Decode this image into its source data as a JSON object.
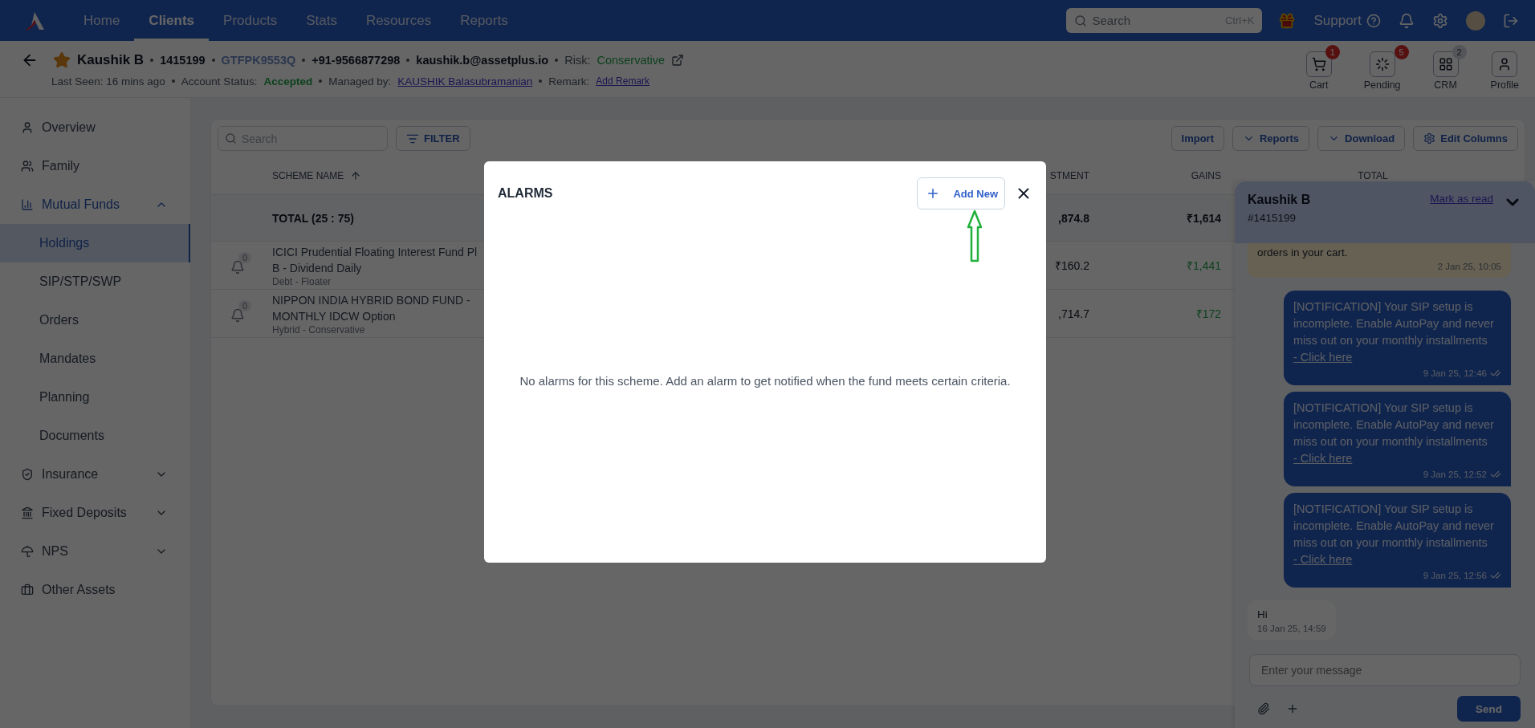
{
  "nav": {
    "links": [
      {
        "label": "Home",
        "selected": false
      },
      {
        "label": "Clients",
        "selected": true
      },
      {
        "label": "Products",
        "selected": false
      },
      {
        "label": "Stats",
        "selected": false
      },
      {
        "label": "Resources",
        "selected": false
      },
      {
        "label": "Reports",
        "selected": false
      }
    ],
    "search": {
      "placeholder": "Search",
      "shortcut": "Ctrl+K"
    },
    "support": "Support"
  },
  "client": {
    "starred": true,
    "name": "Kaushik B",
    "id": "1415199",
    "pan": "GTFPK9553Q",
    "phone": "+91-9566877298",
    "email": "kaushik.b@assetplus.io",
    "risk_label": "Risk:",
    "risk": "Conservative",
    "last_seen": "Last Seen: 16 mins ago",
    "status_label": "Account Status:",
    "status": "Accepted",
    "managed_label": "Managed by:",
    "manager": "KAUSHIK Balasubramanian",
    "remark_label": "Remark:",
    "remark_link": "Add Remark"
  },
  "actions": [
    {
      "label": "Cart",
      "badge": {
        "text": "1",
        "kind": "alert"
      }
    },
    {
      "label": "Pending",
      "badge": {
        "text": "5",
        "kind": "alert"
      }
    },
    {
      "label": "CRM",
      "badge": {
        "text": "2",
        "kind": "muted"
      }
    },
    {
      "label": "Profile"
    }
  ],
  "sidebar": {
    "items": [
      {
        "label": "Overview",
        "selected": false
      },
      {
        "label": "Family",
        "selected": false
      },
      {
        "label": "Mutual Funds",
        "selected": false,
        "expanded": true,
        "children": [
          {
            "label": "Holdings",
            "selected": true
          },
          {
            "label": "SIP/STP/SWP",
            "selected": false
          },
          {
            "label": "Orders",
            "selected": false
          },
          {
            "label": "Mandates",
            "selected": false
          },
          {
            "label": "Planning",
            "selected": false
          },
          {
            "label": "Documents",
            "selected": false
          }
        ]
      },
      {
        "label": "Insurance",
        "selected": false,
        "expanded": false
      },
      {
        "label": "Fixed Deposits",
        "selected": false,
        "expanded": false
      },
      {
        "label": "NPS",
        "selected": false,
        "expanded": false
      },
      {
        "label": "Other Assets",
        "selected": false
      }
    ]
  },
  "toolbar": {
    "search": {
      "placeholder": "Search"
    },
    "filter": "FILTER",
    "buttons": [
      {
        "label": "Import",
        "kind": "plain"
      },
      {
        "label": "Reports",
        "kind": "dropdown"
      },
      {
        "label": "Download",
        "kind": "dropdown"
      },
      {
        "label": "Edit Columns",
        "kind": "settings"
      }
    ]
  },
  "table": {
    "columns": [
      "SCHEME NAME",
      "STMENT",
      "GAINS",
      "TOTAL"
    ],
    "total_row": {
      "label": "TOTAL (25 : 75)",
      "investment": ",874.8",
      "gains": "₹1,614"
    },
    "rows": [
      {
        "name": "ICICI Prudential Floating Interest Fund Pl",
        "name_line2": "B - Dividend Daily",
        "category": "Debt - Floater",
        "alarms": "0",
        "investment": "₹160.2",
        "gains": "₹1,441"
      },
      {
        "name": "NIPPON INDIA HYBRID BOND FUND -",
        "name_line2": "MONTHLY IDCW Option",
        "category": "Hybrid - Conservative",
        "alarms": "0",
        "investment": ",714.7",
        "gains": "₹172"
      }
    ]
  },
  "modal": {
    "title": "ALARMS",
    "add_button": "Add New",
    "message": "No alarms for this scheme. Add an alarm to get notified when the fund meets certain criteria."
  },
  "chat": {
    "name": "Kaushik B",
    "id": "#1415199",
    "mark_read": "Mark as read",
    "messages": [
      {
        "kind": "system",
        "text": "orders in your cart.",
        "time": "2 Jan 25, 10:05"
      },
      {
        "kind": "outgoing",
        "text": "[NOTIFICATION] Your SIP setup is incomplete. Enable AutoPay and never miss out on your monthly installments",
        "link": "- Click here",
        "time": "9 Jan 25, 12:46",
        "read": true
      },
      {
        "kind": "outgoing",
        "text": "[NOTIFICATION] Your SIP setup is incomplete. Enable AutoPay and never miss out on your monthly installments",
        "link": "- Click here",
        "time": "9 Jan 25, 12:52",
        "read": true
      },
      {
        "kind": "outgoing",
        "text": "[NOTIFICATION] Your SIP setup is incomplete. Enable AutoPay and never miss out on your monthly installments",
        "link": "- Click here",
        "time": "9 Jan 25, 12:56",
        "read": true
      },
      {
        "kind": "incoming",
        "text": "Hi",
        "time": "16 Jan 25, 14:59"
      }
    ],
    "input": {
      "placeholder": "Enter your message"
    },
    "send": "Send"
  }
}
